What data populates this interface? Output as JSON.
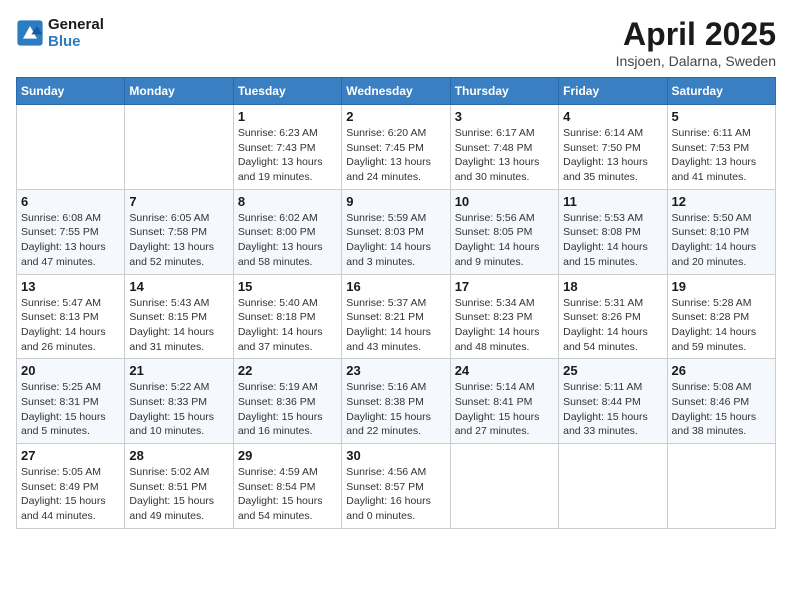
{
  "logo": {
    "line1": "General",
    "line2": "Blue"
  },
  "title": "April 2025",
  "subtitle": "Insjoen, Dalarna, Sweden",
  "weekdays": [
    "Sunday",
    "Monday",
    "Tuesday",
    "Wednesday",
    "Thursday",
    "Friday",
    "Saturday"
  ],
  "weeks": [
    [
      {
        "day": "",
        "info": ""
      },
      {
        "day": "",
        "info": ""
      },
      {
        "day": "1",
        "info": "Sunrise: 6:23 AM\nSunset: 7:43 PM\nDaylight: 13 hours and 19 minutes."
      },
      {
        "day": "2",
        "info": "Sunrise: 6:20 AM\nSunset: 7:45 PM\nDaylight: 13 hours and 24 minutes."
      },
      {
        "day": "3",
        "info": "Sunrise: 6:17 AM\nSunset: 7:48 PM\nDaylight: 13 hours and 30 minutes."
      },
      {
        "day": "4",
        "info": "Sunrise: 6:14 AM\nSunset: 7:50 PM\nDaylight: 13 hours and 35 minutes."
      },
      {
        "day": "5",
        "info": "Sunrise: 6:11 AM\nSunset: 7:53 PM\nDaylight: 13 hours and 41 minutes."
      }
    ],
    [
      {
        "day": "6",
        "info": "Sunrise: 6:08 AM\nSunset: 7:55 PM\nDaylight: 13 hours and 47 minutes."
      },
      {
        "day": "7",
        "info": "Sunrise: 6:05 AM\nSunset: 7:58 PM\nDaylight: 13 hours and 52 minutes."
      },
      {
        "day": "8",
        "info": "Sunrise: 6:02 AM\nSunset: 8:00 PM\nDaylight: 13 hours and 58 minutes."
      },
      {
        "day": "9",
        "info": "Sunrise: 5:59 AM\nSunset: 8:03 PM\nDaylight: 14 hours and 3 minutes."
      },
      {
        "day": "10",
        "info": "Sunrise: 5:56 AM\nSunset: 8:05 PM\nDaylight: 14 hours and 9 minutes."
      },
      {
        "day": "11",
        "info": "Sunrise: 5:53 AM\nSunset: 8:08 PM\nDaylight: 14 hours and 15 minutes."
      },
      {
        "day": "12",
        "info": "Sunrise: 5:50 AM\nSunset: 8:10 PM\nDaylight: 14 hours and 20 minutes."
      }
    ],
    [
      {
        "day": "13",
        "info": "Sunrise: 5:47 AM\nSunset: 8:13 PM\nDaylight: 14 hours and 26 minutes."
      },
      {
        "day": "14",
        "info": "Sunrise: 5:43 AM\nSunset: 8:15 PM\nDaylight: 14 hours and 31 minutes."
      },
      {
        "day": "15",
        "info": "Sunrise: 5:40 AM\nSunset: 8:18 PM\nDaylight: 14 hours and 37 minutes."
      },
      {
        "day": "16",
        "info": "Sunrise: 5:37 AM\nSunset: 8:21 PM\nDaylight: 14 hours and 43 minutes."
      },
      {
        "day": "17",
        "info": "Sunrise: 5:34 AM\nSunset: 8:23 PM\nDaylight: 14 hours and 48 minutes."
      },
      {
        "day": "18",
        "info": "Sunrise: 5:31 AM\nSunset: 8:26 PM\nDaylight: 14 hours and 54 minutes."
      },
      {
        "day": "19",
        "info": "Sunrise: 5:28 AM\nSunset: 8:28 PM\nDaylight: 14 hours and 59 minutes."
      }
    ],
    [
      {
        "day": "20",
        "info": "Sunrise: 5:25 AM\nSunset: 8:31 PM\nDaylight: 15 hours and 5 minutes."
      },
      {
        "day": "21",
        "info": "Sunrise: 5:22 AM\nSunset: 8:33 PM\nDaylight: 15 hours and 10 minutes."
      },
      {
        "day": "22",
        "info": "Sunrise: 5:19 AM\nSunset: 8:36 PM\nDaylight: 15 hours and 16 minutes."
      },
      {
        "day": "23",
        "info": "Sunrise: 5:16 AM\nSunset: 8:38 PM\nDaylight: 15 hours and 22 minutes."
      },
      {
        "day": "24",
        "info": "Sunrise: 5:14 AM\nSunset: 8:41 PM\nDaylight: 15 hours and 27 minutes."
      },
      {
        "day": "25",
        "info": "Sunrise: 5:11 AM\nSunset: 8:44 PM\nDaylight: 15 hours and 33 minutes."
      },
      {
        "day": "26",
        "info": "Sunrise: 5:08 AM\nSunset: 8:46 PM\nDaylight: 15 hours and 38 minutes."
      }
    ],
    [
      {
        "day": "27",
        "info": "Sunrise: 5:05 AM\nSunset: 8:49 PM\nDaylight: 15 hours and 44 minutes."
      },
      {
        "day": "28",
        "info": "Sunrise: 5:02 AM\nSunset: 8:51 PM\nDaylight: 15 hours and 49 minutes."
      },
      {
        "day": "29",
        "info": "Sunrise: 4:59 AM\nSunset: 8:54 PM\nDaylight: 15 hours and 54 minutes."
      },
      {
        "day": "30",
        "info": "Sunrise: 4:56 AM\nSunset: 8:57 PM\nDaylight: 16 hours and 0 minutes."
      },
      {
        "day": "",
        "info": ""
      },
      {
        "day": "",
        "info": ""
      },
      {
        "day": "",
        "info": ""
      }
    ]
  ]
}
